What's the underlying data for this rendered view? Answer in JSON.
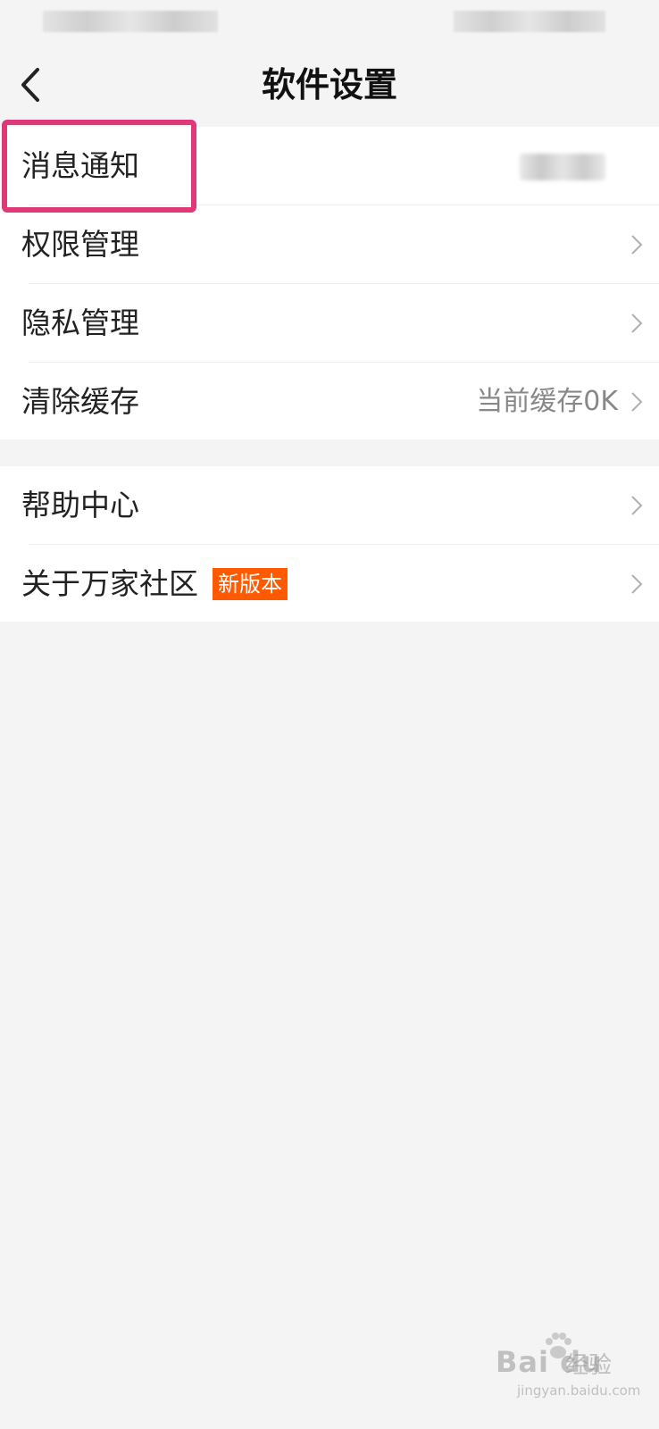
{
  "header": {
    "title": "软件设置"
  },
  "group1": [
    {
      "label": "消息通知",
      "value": ""
    },
    {
      "label": "权限管理",
      "value": ""
    },
    {
      "label": "隐私管理",
      "value": ""
    },
    {
      "label": "清除缓存",
      "value": "当前缓存0K"
    }
  ],
  "group2": [
    {
      "label": "帮助中心",
      "badge": ""
    },
    {
      "label": "关于万家社区",
      "badge": "新版本"
    }
  ],
  "colors": {
    "highlight": "#e0397a",
    "badge": "#ff5a00",
    "background": "#f4f4f4"
  },
  "icons": {
    "back": "chevron-left-icon",
    "row_arrow": "chevron-right-icon"
  },
  "watermark": {
    "brand": "Bai du",
    "cn": "经验",
    "url": "jingyan.baidu.com"
  }
}
